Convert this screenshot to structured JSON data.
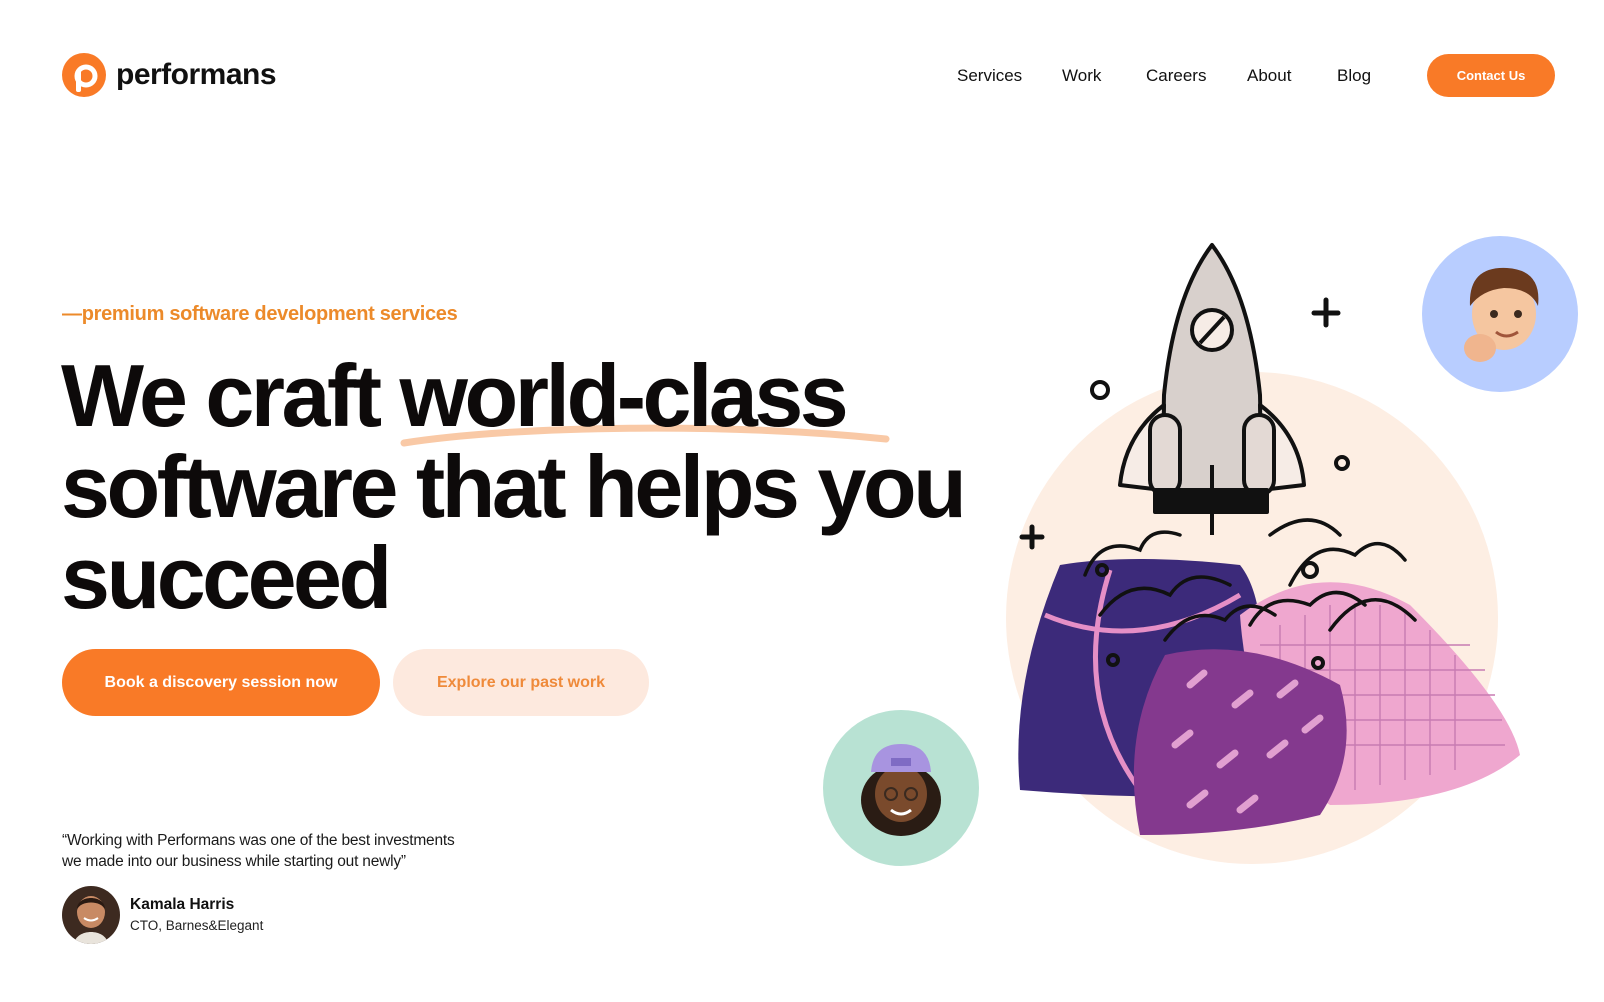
{
  "brand": {
    "name": "performans",
    "accent": "#f97a27"
  },
  "nav": {
    "items": [
      {
        "label": "Services"
      },
      {
        "label": "Work"
      },
      {
        "label": "Careers"
      },
      {
        "label": "About"
      },
      {
        "label": "Blog"
      }
    ],
    "cta_label": "Contact Us"
  },
  "hero": {
    "eyebrow": "—premium software development services",
    "headline_lines": [
      "We craft world-class",
      "software that helps you",
      "succeed"
    ],
    "primary_button": "Book a discovery session now",
    "secondary_button": "Explore our past work"
  },
  "testimonial": {
    "quote_lines": [
      "“Working with Performans was one of the best investments",
      "we made into our business while starting out newly”"
    ],
    "author_name": "Kamala Harris",
    "author_title": "CTO, Barnes&Elegant"
  },
  "icons": {
    "logo": "performans-logo-icon",
    "rocket": "rocket-illustration",
    "avatar_top": "memoji-avatar-man",
    "avatar_bottom": "memoji-avatar-woman"
  }
}
